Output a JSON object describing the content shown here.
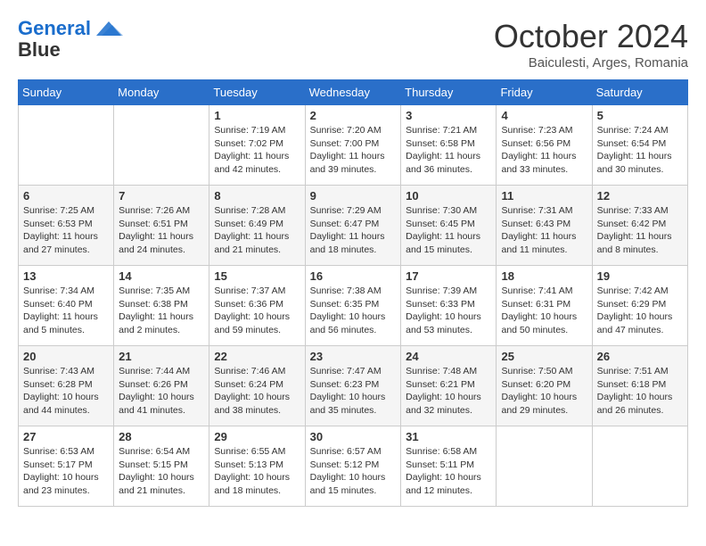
{
  "header": {
    "logo_line1": "General",
    "logo_line2": "Blue",
    "month": "October 2024",
    "location": "Baiculesti, Arges, Romania"
  },
  "days_of_week": [
    "Sunday",
    "Monday",
    "Tuesday",
    "Wednesday",
    "Thursday",
    "Friday",
    "Saturday"
  ],
  "weeks": [
    [
      {
        "day": "",
        "info": ""
      },
      {
        "day": "",
        "info": ""
      },
      {
        "day": "1",
        "info": "Sunrise: 7:19 AM\nSunset: 7:02 PM\nDaylight: 11 hours and 42 minutes."
      },
      {
        "day": "2",
        "info": "Sunrise: 7:20 AM\nSunset: 7:00 PM\nDaylight: 11 hours and 39 minutes."
      },
      {
        "day": "3",
        "info": "Sunrise: 7:21 AM\nSunset: 6:58 PM\nDaylight: 11 hours and 36 minutes."
      },
      {
        "day": "4",
        "info": "Sunrise: 7:23 AM\nSunset: 6:56 PM\nDaylight: 11 hours and 33 minutes."
      },
      {
        "day": "5",
        "info": "Sunrise: 7:24 AM\nSunset: 6:54 PM\nDaylight: 11 hours and 30 minutes."
      }
    ],
    [
      {
        "day": "6",
        "info": "Sunrise: 7:25 AM\nSunset: 6:53 PM\nDaylight: 11 hours and 27 minutes."
      },
      {
        "day": "7",
        "info": "Sunrise: 7:26 AM\nSunset: 6:51 PM\nDaylight: 11 hours and 24 minutes."
      },
      {
        "day": "8",
        "info": "Sunrise: 7:28 AM\nSunset: 6:49 PM\nDaylight: 11 hours and 21 minutes."
      },
      {
        "day": "9",
        "info": "Sunrise: 7:29 AM\nSunset: 6:47 PM\nDaylight: 11 hours and 18 minutes."
      },
      {
        "day": "10",
        "info": "Sunrise: 7:30 AM\nSunset: 6:45 PM\nDaylight: 11 hours and 15 minutes."
      },
      {
        "day": "11",
        "info": "Sunrise: 7:31 AM\nSunset: 6:43 PM\nDaylight: 11 hours and 11 minutes."
      },
      {
        "day": "12",
        "info": "Sunrise: 7:33 AM\nSunset: 6:42 PM\nDaylight: 11 hours and 8 minutes."
      }
    ],
    [
      {
        "day": "13",
        "info": "Sunrise: 7:34 AM\nSunset: 6:40 PM\nDaylight: 11 hours and 5 minutes."
      },
      {
        "day": "14",
        "info": "Sunrise: 7:35 AM\nSunset: 6:38 PM\nDaylight: 11 hours and 2 minutes."
      },
      {
        "day": "15",
        "info": "Sunrise: 7:37 AM\nSunset: 6:36 PM\nDaylight: 10 hours and 59 minutes."
      },
      {
        "day": "16",
        "info": "Sunrise: 7:38 AM\nSunset: 6:35 PM\nDaylight: 10 hours and 56 minutes."
      },
      {
        "day": "17",
        "info": "Sunrise: 7:39 AM\nSunset: 6:33 PM\nDaylight: 10 hours and 53 minutes."
      },
      {
        "day": "18",
        "info": "Sunrise: 7:41 AM\nSunset: 6:31 PM\nDaylight: 10 hours and 50 minutes."
      },
      {
        "day": "19",
        "info": "Sunrise: 7:42 AM\nSunset: 6:29 PM\nDaylight: 10 hours and 47 minutes."
      }
    ],
    [
      {
        "day": "20",
        "info": "Sunrise: 7:43 AM\nSunset: 6:28 PM\nDaylight: 10 hours and 44 minutes."
      },
      {
        "day": "21",
        "info": "Sunrise: 7:44 AM\nSunset: 6:26 PM\nDaylight: 10 hours and 41 minutes."
      },
      {
        "day": "22",
        "info": "Sunrise: 7:46 AM\nSunset: 6:24 PM\nDaylight: 10 hours and 38 minutes."
      },
      {
        "day": "23",
        "info": "Sunrise: 7:47 AM\nSunset: 6:23 PM\nDaylight: 10 hours and 35 minutes."
      },
      {
        "day": "24",
        "info": "Sunrise: 7:48 AM\nSunset: 6:21 PM\nDaylight: 10 hours and 32 minutes."
      },
      {
        "day": "25",
        "info": "Sunrise: 7:50 AM\nSunset: 6:20 PM\nDaylight: 10 hours and 29 minutes."
      },
      {
        "day": "26",
        "info": "Sunrise: 7:51 AM\nSunset: 6:18 PM\nDaylight: 10 hours and 26 minutes."
      }
    ],
    [
      {
        "day": "27",
        "info": "Sunrise: 6:53 AM\nSunset: 5:17 PM\nDaylight: 10 hours and 23 minutes."
      },
      {
        "day": "28",
        "info": "Sunrise: 6:54 AM\nSunset: 5:15 PM\nDaylight: 10 hours and 21 minutes."
      },
      {
        "day": "29",
        "info": "Sunrise: 6:55 AM\nSunset: 5:13 PM\nDaylight: 10 hours and 18 minutes."
      },
      {
        "day": "30",
        "info": "Sunrise: 6:57 AM\nSunset: 5:12 PM\nDaylight: 10 hours and 15 minutes."
      },
      {
        "day": "31",
        "info": "Sunrise: 6:58 AM\nSunset: 5:11 PM\nDaylight: 10 hours and 12 minutes."
      },
      {
        "day": "",
        "info": ""
      },
      {
        "day": "",
        "info": ""
      }
    ]
  ]
}
